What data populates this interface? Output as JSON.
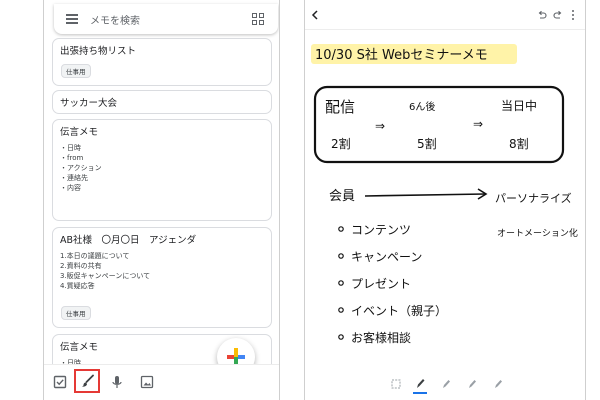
{
  "left_screen": {
    "search": {
      "placeholder": "メモを検索"
    },
    "notes": [
      {
        "title": "出張持ち物リスト",
        "label": "仕事用"
      },
      {
        "title": "サッカー大会"
      },
      {
        "title": "伝言メモ",
        "lines": [
          "・日時",
          "・from",
          "・アクション",
          "・連絡先",
          "・内容"
        ]
      },
      {
        "title": "AB社様　〇月〇日　アジェンダ",
        "lines": [
          "1.本日の議題について",
          "2.資料の共有",
          "3.販促キャンペーンについて",
          "4.質疑応答"
        ],
        "label": "仕事用"
      },
      {
        "title": "伝言メモ",
        "lines": [
          "・日時"
        ]
      }
    ],
    "bottom_bar": {
      "icons": [
        "checkbox-icon",
        "brush-icon",
        "mic-icon",
        "image-icon"
      ],
      "highlight_color": "#e53935"
    },
    "fab_icon": "plus-icon"
  },
  "right_screen": {
    "handwriting": {
      "title": "10/30 S社 Webセミナーメモ",
      "box": {
        "columns": [
          {
            "header": "配信",
            "value": "2割"
          },
          {
            "header": "6ん後",
            "value": "5割"
          },
          {
            "header": "当日中",
            "value": "8割"
          }
        ]
      },
      "heading": "会員",
      "arrow_target": "パーソナライズ",
      "side_note": "オートメーション化",
      "bullets": [
        "コンテンツ",
        "キャンペーン",
        "プレゼント",
        "イベント（親子）",
        "お客様相談"
      ]
    },
    "toolbar_icons": [
      "back-icon",
      "undo-icon",
      "redo-icon",
      "more-icon"
    ],
    "pen_tools": [
      "select-tool-icon",
      "pen-icon",
      "marker-icon",
      "highlighter-icon",
      "eraser-icon"
    ],
    "highlight_color": "#fff3a8"
  }
}
